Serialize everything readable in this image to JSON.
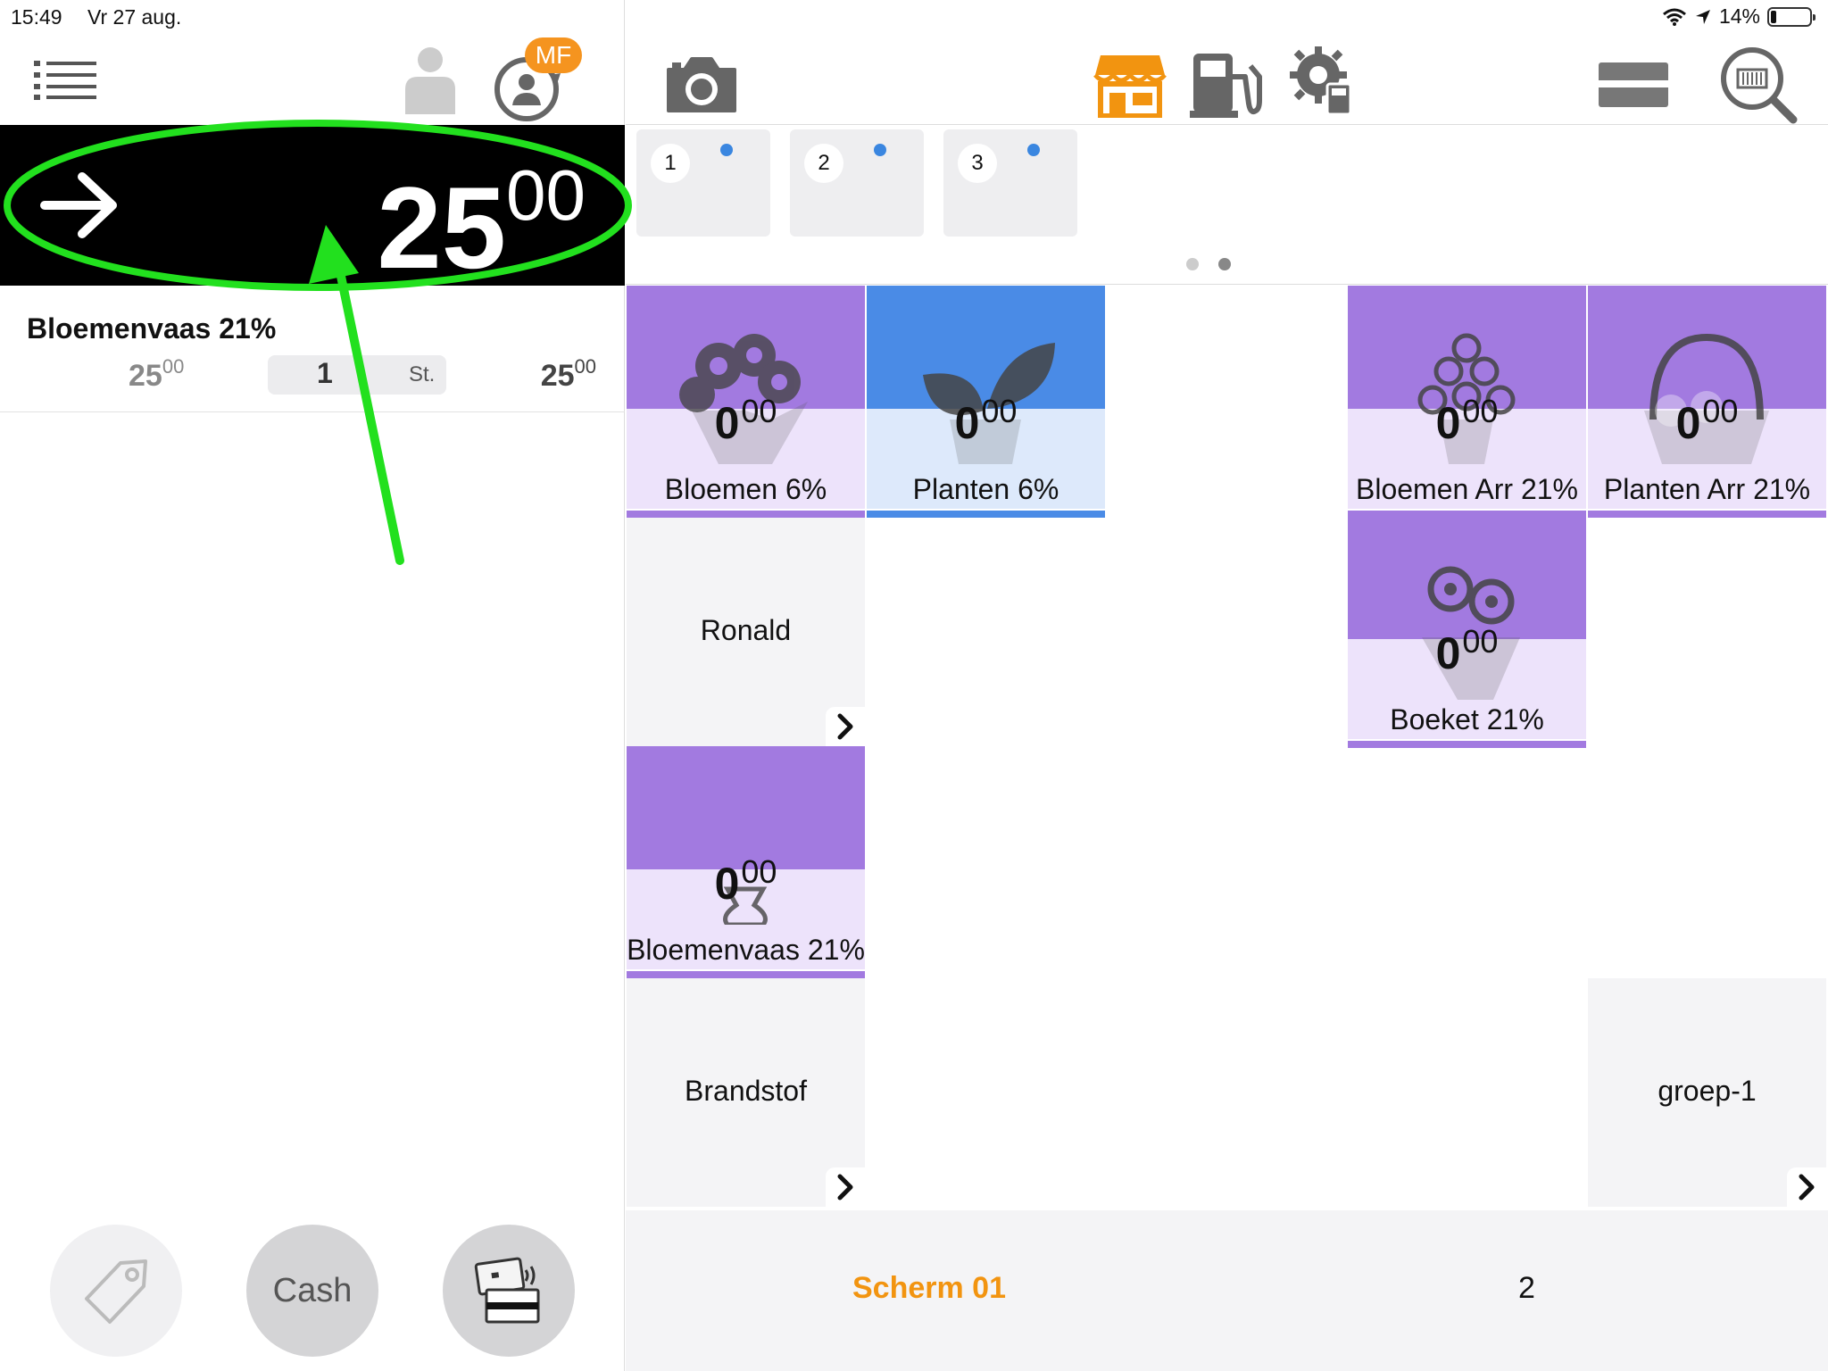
{
  "status_bar": {
    "time": "15:49",
    "date": "Vr 27 aug.",
    "battery": "14%",
    "battery_level": 0.14
  },
  "header": {
    "user_badge": "MF"
  },
  "total": {
    "integer": "25",
    "decimals": "00"
  },
  "order": {
    "name": "Bloemenvaas 21%",
    "unit_price_int": "25",
    "unit_price_dec": "00",
    "quantity": "1",
    "unit": "St.",
    "line_total_int": "25",
    "line_total_dec": "00"
  },
  "payment": {
    "cash_label": "Cash"
  },
  "screen_tabs": [
    "1",
    "2",
    "3"
  ],
  "tiles": [
    {
      "label": "Bloemen 6%",
      "price_int": "0",
      "price_dec": "00",
      "color": "#a27ae0",
      "icon": "flower-bouquet-icon"
    },
    {
      "label": "Planten 6%",
      "price_int": "0",
      "price_dec": "00",
      "color": "#4a8be6",
      "icon": "plant-icon"
    },
    {
      "label": "Bloemen Arr 21%",
      "price_int": "0",
      "price_dec": "00",
      "color": "#a27ae0",
      "icon": "flower-arrangement-icon"
    },
    {
      "label": "Planten Arr 21%",
      "price_int": "0",
      "price_dec": "00",
      "color": "#a27ae0",
      "icon": "basket-icon"
    },
    {
      "label": "Boeket 21%",
      "price_int": "0",
      "price_dec": "00",
      "color": "#a27ae0",
      "icon": "bouquet-icon"
    },
    {
      "label": "Bloemenvaas 21%",
      "price_int": "0",
      "price_dec": "00",
      "color": "#a27ae0",
      "icon": "vase-icon"
    }
  ],
  "groups": [
    "Ronald",
    "Brandstof",
    "groep-1"
  ],
  "footer": {
    "screen1": "Scherm 01",
    "screen2": "2"
  },
  "annotation_color": "#22e01e",
  "accent_color": "#f29410"
}
